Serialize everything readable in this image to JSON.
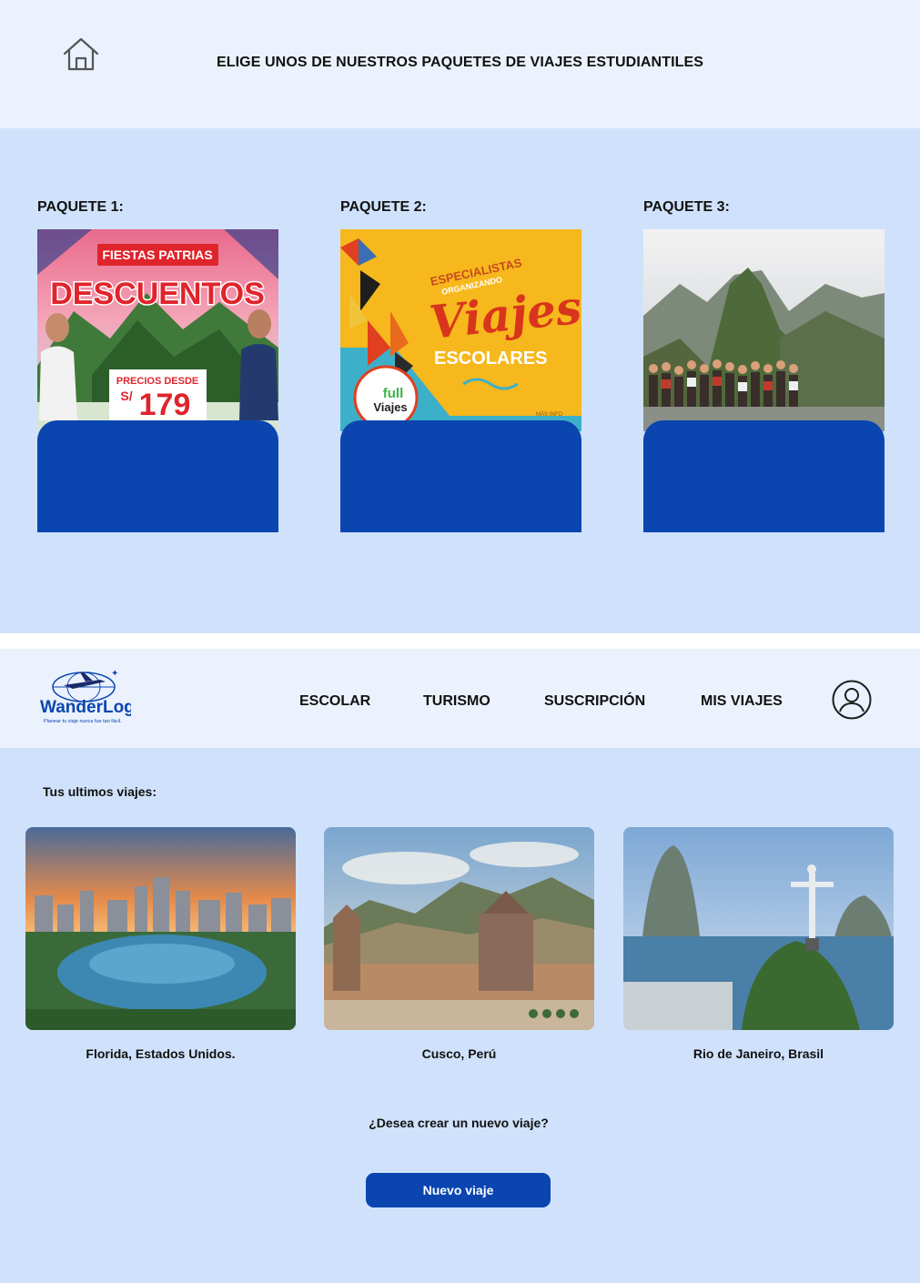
{
  "header": {
    "title": "ELIGE UNOS DE NUESTROS PAQUETES DE VIAJES ESTUDIANTILES",
    "home_icon": "home-icon"
  },
  "packages": [
    {
      "label": "PAQUETE 1:",
      "promo": {
        "banner": "FIESTAS PATRIAS",
        "headline": "DESCUENTOS",
        "price_caption": "PRECIOS DESDE",
        "currency": "S/",
        "price": "179"
      }
    },
    {
      "label": "PAQUETE 2:",
      "promo": {
        "line1": "ESPECIALISTAS",
        "line2": "ORGANIZANDO",
        "headline": "Viajes",
        "subheadline": "ESCOLARES",
        "brand_top": "full",
        "brand_bottom": "Viajes",
        "more_info": "MÁS INFO"
      }
    },
    {
      "label": "PAQUETE 3:"
    }
  ],
  "nav": {
    "logo_name": "WanderLog",
    "logo_tagline": "Planear tu viaje nunca fue tan fácil.",
    "items": [
      "ESCOLAR",
      "TURISMO",
      "SUSCRIPCIÓN",
      "MIS VIAJES"
    ],
    "user_icon": "user-avatar-icon"
  },
  "recent": {
    "title": "Tus ultimos viajes:",
    "trips": [
      {
        "label": "Florida, Estados Unidos."
      },
      {
        "label": "Cusco, Perú"
      },
      {
        "label": "Rio de Janeiro, Brasil"
      }
    ]
  },
  "cta": {
    "question": "¿Desea crear un nuevo viaje?",
    "button_label": "Nuevo viaje"
  },
  "colors": {
    "primary": "#0a45b0",
    "page_background": "#d0e2fb",
    "header_background": "#ebf2fd"
  }
}
